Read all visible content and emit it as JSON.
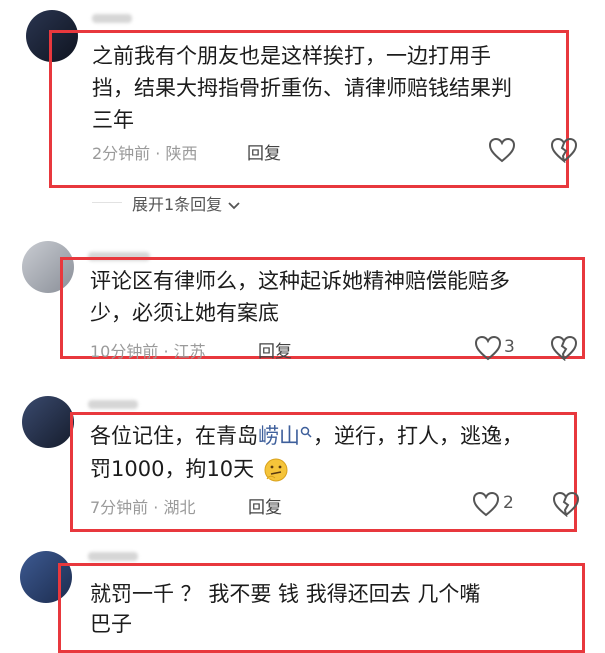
{
  "comments": [
    {
      "lines": [
        "之前我有个朋友也是这样挨打，一边打用手",
        "挡，结果大拇指骨折重伤、请律师赔钱结果判",
        "三年"
      ],
      "time": "2分钟前",
      "location": "陕西",
      "reply_label": "回复",
      "like_count": "",
      "expand_label": "展开1条回复"
    },
    {
      "lines": [
        "评论区有律师么，这种起诉她精神赔偿能赔多",
        "少，必须让她有案底"
      ],
      "time": "10分钟前",
      "location": "江苏",
      "reply_label": "回复",
      "like_count": "3"
    },
    {
      "line1_before": "各位记住，在青岛",
      "line1_link": "崂山",
      "line1_after": "，逆行，打人，逃逸，",
      "line2": "罚1000，拘10天",
      "time": "7分钟前",
      "location": "湖北",
      "reply_label": "回复",
      "like_count": "2"
    },
    {
      "lines": [
        "就罚一千  ？ 我不要 钱  我得还回去 几个嘴",
        "巴子"
      ]
    }
  ],
  "separator": "·",
  "icons": {
    "like": "heart-outline-icon",
    "dislike": "broken-heart-icon",
    "search": "search-icon",
    "emoji": "thinking-emoji-icon",
    "chevron": "chevron-down-icon"
  },
  "colors": {
    "highlight_frame": "#e8383d",
    "link": "#3e5f9b"
  }
}
